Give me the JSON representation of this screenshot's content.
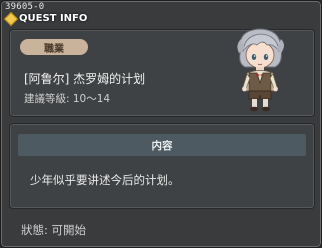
{
  "window": {
    "code": "39605-0",
    "title": "QUEST INFO"
  },
  "info": {
    "job_label": "職業",
    "quest_name": "[阿鲁尔] 杰罗姆的计划",
    "level_recommendation": "建議等級: 10～14"
  },
  "description": {
    "header": "内容",
    "text": "少年似乎要讲述今后的计划。"
  },
  "status": {
    "text": "狀態: 可開始"
  },
  "colors": {
    "window_bg": "#3a3b3d",
    "panel_bg": "#3f4244",
    "job_badge": "#c9b39a",
    "desc_header": "#4d5a62",
    "title_icon": "#f2c94c"
  },
  "icons": {
    "title": "diamond-icon",
    "portrait": "npc-boy-portrait"
  }
}
